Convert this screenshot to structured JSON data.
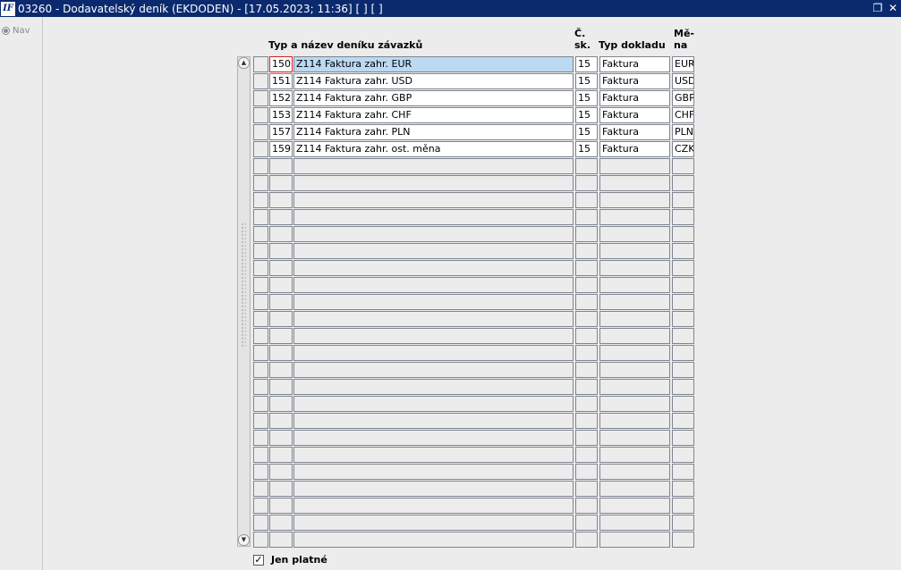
{
  "window": {
    "logo_text": "IF",
    "title": "03260 - Dodavatelský deník (EKDODEN) - [17.05.2023; 11:36]  [ ]  [ ]",
    "restore_glyph": "❐",
    "close_glyph": "✕"
  },
  "nav": {
    "label": "Nav"
  },
  "columns": {
    "name": "Typ a název deníku závazků",
    "sk_line1": "Č.",
    "sk_line2": "sk.",
    "typ": "Typ dokladu",
    "mena_line1": "Mě-",
    "mena_line2": "na"
  },
  "rows": [
    {
      "num": "150",
      "name": "Z114 Faktura zahr. EUR",
      "sk": "15",
      "typ": "Faktura",
      "mena": "EUR"
    },
    {
      "num": "151",
      "name": "Z114 Faktura zahr. USD",
      "sk": "15",
      "typ": "Faktura",
      "mena": "USD"
    },
    {
      "num": "152",
      "name": "Z114 Faktura zahr. GBP",
      "sk": "15",
      "typ": "Faktura",
      "mena": "GBP"
    },
    {
      "num": "153",
      "name": "Z114 Faktura zahr. CHF",
      "sk": "15",
      "typ": "Faktura",
      "mena": "CHF"
    },
    {
      "num": "157",
      "name": "Z114 Faktura zahr. PLN",
      "sk": "15",
      "typ": "Faktura",
      "mena": "PLN"
    },
    {
      "num": "159",
      "name": "Z114 Faktura zahr. ost. měna",
      "sk": "15",
      "typ": "Faktura",
      "mena": "CZK"
    }
  ],
  "empty_row_count": 23,
  "current_row_index": 0,
  "scrollbar": {
    "up_glyph": "▲",
    "down_glyph": "▼"
  },
  "filter": {
    "label": "Jen platné",
    "checked": true,
    "check_glyph": "✓"
  },
  "colors": {
    "titlebar": "#0b2a6e",
    "selected_row": "#bcd8f3",
    "focus_border": "#d42020"
  }
}
